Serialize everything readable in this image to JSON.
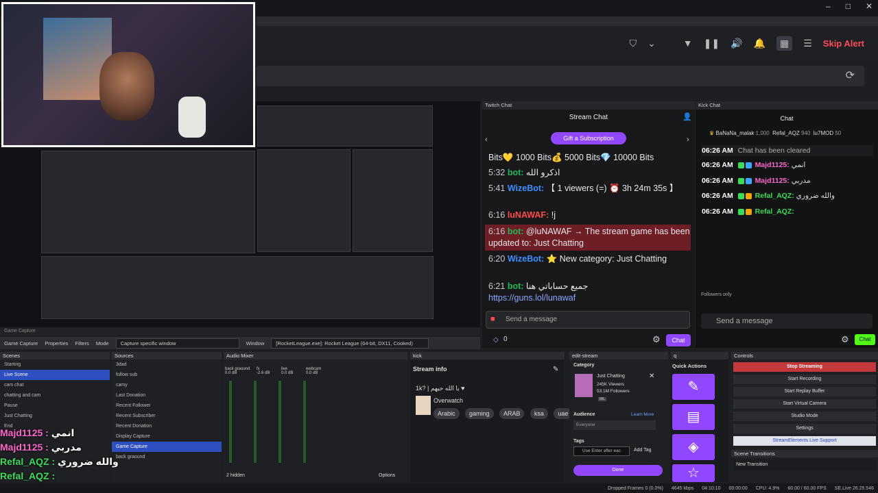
{
  "window": {
    "controls": [
      "–",
      "□",
      "✕"
    ]
  },
  "alert_bar": {
    "skip_alert": "Skip Alert",
    "icons": [
      "shield-icon",
      "chevron-down-icon",
      "filter-icon",
      "pause-icon",
      "volume-icon",
      "bell-icon",
      "grid-icon",
      "list-icon"
    ]
  },
  "preview_bar": {
    "text": "Game Capture"
  },
  "twitch_chat": {
    "panel_title": "Twitch Chat",
    "title": "Stream Chat",
    "gift_button": "Gift a Subscription",
    "messages": [
      {
        "time": "",
        "user": "",
        "text": "Bits💛 1000 Bits💰 5000 Bits💎 10000 Bits"
      },
      {
        "time": "5:32",
        "user": "bot:",
        "text": "اذكرو الله"
      },
      {
        "time": "5:41",
        "user": "WizeBot:",
        "text": "【 1 viewers (=) ⏰ 3h 24m 35s 】"
      },
      {
        "time": "6:16",
        "user": "luNAWAF:",
        "text": "!j"
      },
      {
        "time": "6:16",
        "user": "bot:",
        "text": "@luNAWAF → The stream game has been updated to: Just Chatting"
      },
      {
        "time": "6:20",
        "user": "WizeBot:",
        "text": "⭐ New category: Just Chatting"
      },
      {
        "time": "6:21",
        "user": "bot:",
        "text": "جميع حساباتي هنا",
        "link": "https://guns.lol/lunawaf"
      }
    ],
    "send_placeholder": "Send a message",
    "points": "0",
    "chat_button": "Chat"
  },
  "kick_chat": {
    "panel_title": "Kick Chat",
    "title": "Chat",
    "leaders": [
      {
        "name": "BaNaNa_malak",
        "value": "1,000"
      },
      {
        "name": "Refal_AQZ",
        "value": "940"
      },
      {
        "name": "lu7MOD",
        "value": "50"
      }
    ],
    "cleared": {
      "time": "06:26 AM",
      "text": "Chat has been cleared"
    },
    "messages": [
      {
        "time": "06:26 AM",
        "user": "Majd1125:",
        "text": "انمي"
      },
      {
        "time": "06:26 AM",
        "user": "Majd1125:",
        "text": "مدربي"
      },
      {
        "time": "06:26 AM",
        "user": "Refal_AQZ:",
        "text": "والله ضروري"
      },
      {
        "time": "06:26 AM",
        "user": "Refal_AQZ:",
        "text": ""
      }
    ],
    "followers_only": "Followers only",
    "send_placeholder": "Send a message",
    "chat_button": "Chat"
  },
  "obs": {
    "source_bar": {
      "source": "Game Capture",
      "properties": "Properties",
      "filters": "Filters",
      "mode_label": "Mode",
      "mode_value": "Capture specific window",
      "window_label": "Window",
      "window_value": "[RocketLeague.exe]: Rocket League (64-bit, DX11, Cooked)"
    },
    "scenes": {
      "title": "Scenes",
      "items": [
        "Starting",
        "Live Scene",
        "cam chat",
        "chatting and cam",
        "Pause",
        "Just Chatting",
        "End"
      ]
    },
    "sources": {
      "title": "Sources",
      "items": [
        "3dad",
        "follow sub",
        "camy",
        "Last Donation",
        "Recent Follower",
        "Recent Subscriber",
        "Recent Donation",
        "Display Capture",
        "Game Capture",
        "back graound"
      ]
    },
    "audio_mixer": {
      "title": "Audio Mixer",
      "channels": [
        {
          "name": "back graound",
          "value": "0.0 dB"
        },
        {
          "name": "fx",
          "value": "-2.6 dB"
        },
        {
          "name": "live",
          "value": "0.0 dB"
        },
        {
          "name": "webcam",
          "value": "0.0 dB"
        }
      ],
      "hidden": "2 hidden",
      "options": "Options"
    },
    "kick_panel": {
      "title": "kick",
      "stream_info": "Stream info",
      "stream_title": "1k? | يا الله حيهم ♥",
      "category": "Overwatch",
      "tags": [
        "Arabic",
        "gaming",
        "ARAB",
        "ksa",
        "uae"
      ]
    },
    "edit_stream": {
      "title": "edit-stream",
      "category_label": "Category",
      "category_name": "Just Chatting",
      "viewers": "245K Viewers",
      "followers": "53.1M Followers",
      "badge": "IRL",
      "audience_label": "Audience",
      "learn_more": "Learn More",
      "audience_value": "Everyone",
      "tags_label": "Tags",
      "tags_placeholder": "Use Enter after eac",
      "add_tag": "Add Tag",
      "done": "Done"
    },
    "quick_actions": {
      "panel": "q",
      "title": "Quick Actions"
    },
    "controls": {
      "title": "Controls",
      "buttons": [
        "Stop Streaming",
        "Start Recording",
        "Start Replay Buffer",
        "Start Virtual Camera",
        "Studio Mode",
        "Settings",
        "StreamElements Live Support"
      ]
    },
    "scene_transitions": {
      "title": "Scene Transitions",
      "value": "New Transition"
    },
    "status": {
      "dropped": "Dropped Frames 0 (0.0%)",
      "bitrate": "4645 kbps",
      "time": "04:10:10",
      "rec": "00:00:00",
      "cpu": "CPU: 4.9%",
      "fps": "60.00 / 60.00 FPS",
      "version": "SE.Live 26.25.546"
    }
  },
  "overlay_chat": [
    {
      "user": "Majd1125 :",
      "text": "انمي",
      "color": "pink"
    },
    {
      "user": "Majd1125 :",
      "text": "مدربي",
      "color": "pink"
    },
    {
      "user": "Refal_AQZ :",
      "text": "والله ضروري",
      "color": "green"
    },
    {
      "user": "Refal_AQZ :",
      "text": "",
      "color": "green"
    }
  ],
  "colors": {
    "twitch_purple": "#9147ff",
    "kick_green": "#53fc18",
    "stop_red": "#c2383b",
    "skip_red": "#ff4b5c"
  }
}
